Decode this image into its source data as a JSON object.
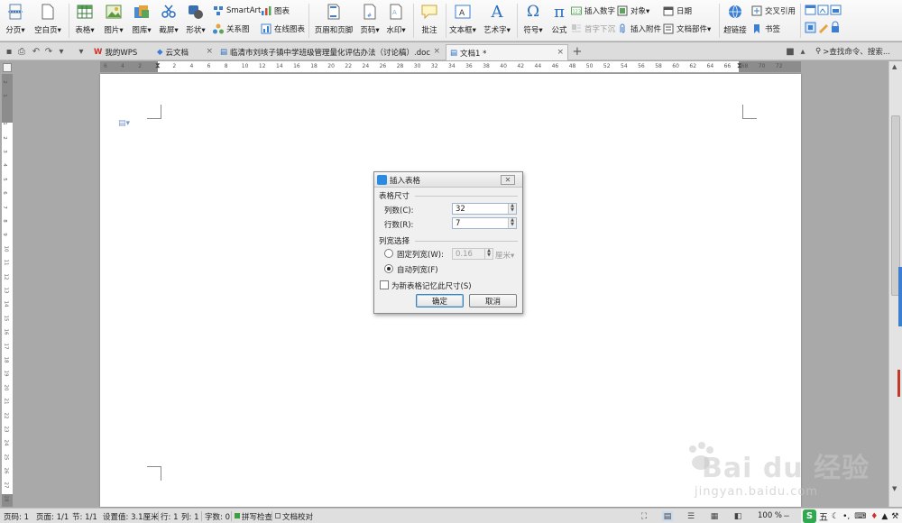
{
  "ribbon": {
    "big": [
      {
        "id": "page-break",
        "label": "分页▾",
        "icon": "page-break-icon"
      },
      {
        "id": "blank-page",
        "label": "空白页▾",
        "icon": "blank-page-icon"
      },
      {
        "id": "table",
        "label": "表格▾",
        "icon": "table-icon"
      },
      {
        "id": "picture",
        "label": "图片▾",
        "icon": "picture-icon"
      },
      {
        "id": "gallery",
        "label": "图库▾",
        "icon": "gallery-icon"
      },
      {
        "id": "screenshot",
        "label": "截屏▾",
        "icon": "screenshot-icon"
      },
      {
        "id": "shape",
        "label": "形状▾",
        "icon": "shape-icon"
      },
      {
        "id": "header-footer",
        "label": "页眉和页脚",
        "icon": "header-footer-icon"
      },
      {
        "id": "page-number",
        "label": "页码▾",
        "icon": "page-number-icon"
      },
      {
        "id": "watermark",
        "label": "水印▾",
        "icon": "watermark-icon"
      },
      {
        "id": "comment",
        "label": "批注",
        "icon": "comment-icon"
      },
      {
        "id": "textbox",
        "label": "文本框▾",
        "icon": "textbox-icon"
      },
      {
        "id": "wordart",
        "label": "艺术字▾",
        "icon": "wordart-icon"
      },
      {
        "id": "symbol",
        "label": "符号▾",
        "icon": "symbol-icon"
      },
      {
        "id": "formula",
        "label": "公式",
        "icon": "formula-icon"
      },
      {
        "id": "hyperlink",
        "label": "超链接",
        "icon": "hyperlink-icon"
      }
    ],
    "small": {
      "smartart": "SmartArt",
      "chart": "图表",
      "relation": "关系图",
      "online_chart": "在线图表",
      "insert_number": "插入数字",
      "object": "对象▾",
      "date": "日期",
      "dropcap": "首字下沉",
      "attachment": "插入附件",
      "doc_parts": "文档部件▾",
      "cross_ref": "交叉引用",
      "bookmark": "书签"
    },
    "formula_glyph": "π",
    "symbol_glyph": "Ω",
    "wordart_glyph": "A"
  },
  "tabs": {
    "wps": "我的WPS",
    "cloud": "云文档",
    "doc": "临清市刘垓子镇中学班级管理量化评估办法（讨论稿）.doc",
    "new_doc": "文档1 *",
    "add": "+",
    "search": ">查找命令、搜索..."
  },
  "ruler": {
    "h_ticks": [
      "6",
      "4",
      "2",
      "",
      "2",
      "4",
      "6",
      "8",
      "10",
      "12",
      "14",
      "16",
      "18",
      "20",
      "22",
      "24",
      "26",
      "28",
      "30",
      "32",
      "34",
      "36",
      "38",
      "40",
      "42",
      "44",
      "46",
      "48",
      "50",
      "52",
      "54",
      "56",
      "58",
      "60",
      "62",
      "64",
      "66",
      "68",
      "70",
      "72"
    ]
  },
  "dialog": {
    "title": "插入表格",
    "group_size": "表格尺寸",
    "cols_label": "列数(C):",
    "cols_value": "32",
    "rows_label": "行数(R):",
    "rows_value": "7",
    "group_width": "列宽选择",
    "fixed_label": "固定列宽(W):",
    "fixed_value": "0.16",
    "unit": "厘米▾",
    "auto_label": "自动列宽(F)",
    "remember_label": "为新表格记忆此尺寸(S)",
    "ok": "确定",
    "cancel": "取消",
    "close": "✕"
  },
  "status": {
    "page_num": "页码: 1",
    "pages": "页面: 1/1",
    "section": "节: 1/1",
    "setting": "设置值: 3.1厘米",
    "row": "行: 1",
    "col": "列: 1",
    "words": "字数: 0",
    "spell": "拼写检查",
    "proof": "文档校对",
    "zoom": "100 %"
  },
  "watermark": {
    "main": "Bai du 经验",
    "sub": "jingyan.baidu.com"
  },
  "ime": {
    "label": "五"
  }
}
